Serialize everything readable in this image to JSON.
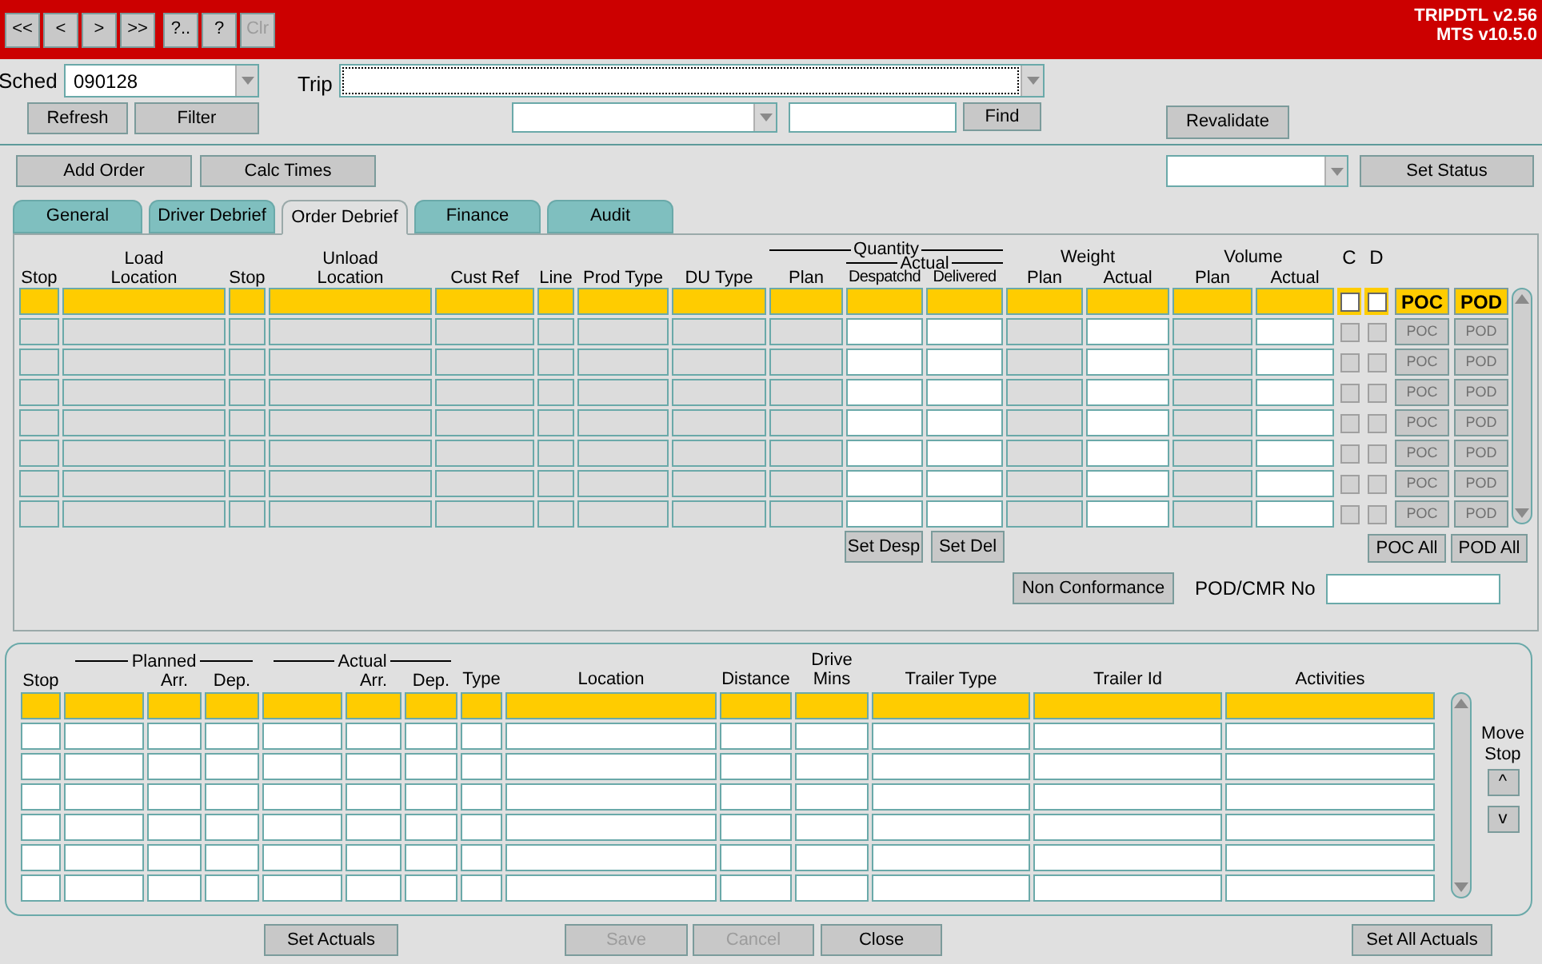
{
  "toolbar": {
    "buttons": [
      {
        "label": "<<",
        "disabled": false
      },
      {
        "label": "<",
        "disabled": false
      },
      {
        "label": ">",
        "disabled": false
      },
      {
        "label": ">>",
        "disabled": false
      },
      {
        "label": "?..",
        "disabled": false
      },
      {
        "label": "?",
        "disabled": false
      },
      {
        "label": "Clr",
        "disabled": true
      }
    ]
  },
  "app_info": [
    "TRIPDTL v2.56",
    "MTS v10.5.0"
  ],
  "sched": {
    "label": "Sched",
    "value": "090128"
  },
  "trip": {
    "label": "Trip",
    "focused": true
  },
  "schedule_buttons": [
    "Refresh",
    "Filter"
  ],
  "find_button": "Find",
  "revalidate_button": "Revalidate",
  "order_buttons": [
    "Add Order",
    "Calc Times"
  ],
  "set_status_button": "Set Status",
  "tabs": [
    {
      "label": "General",
      "selected": false
    },
    {
      "label": "Driver Debrief",
      "selected": false
    },
    {
      "label": "Order Debrief",
      "selected": true
    },
    {
      "label": "Finance",
      "selected": false
    },
    {
      "label": "Audit",
      "selected": false
    }
  ],
  "order_grid": {
    "groups": {
      "quantity": "Quantity",
      "actual": "Actual",
      "weight": "Weight",
      "volume": "Volume"
    },
    "columns": [
      {
        "label": "Stop",
        "editable": false
      },
      {
        "label": "Load\nLocation",
        "editable": false
      },
      {
        "label": "Stop",
        "editable": false
      },
      {
        "label": "Unload\nLocation",
        "editable": false
      },
      {
        "label": "Cust Ref",
        "editable": false
      },
      {
        "label": "Line",
        "editable": false
      },
      {
        "label": "Prod Type",
        "editable": false
      },
      {
        "label": "DU Type",
        "editable": false
      },
      {
        "label": "Plan",
        "editable": false
      },
      {
        "label": "Despatchd",
        "editable": true
      },
      {
        "label": "Delivered",
        "editable": true
      },
      {
        "label": "Plan",
        "editable": false
      },
      {
        "label": "Actual",
        "editable": true
      },
      {
        "label": "Plan",
        "editable": false
      },
      {
        "label": "Actual",
        "editable": true
      },
      {
        "label": "C"
      },
      {
        "label": "D"
      }
    ],
    "rows": [
      {
        "selected": true,
        "c_checked": false,
        "d_checked": false,
        "poc": "POC",
        "pod": "POD"
      },
      {
        "selected": false,
        "c_checked": false,
        "d_checked": false,
        "poc": "POC",
        "pod": "POD"
      },
      {
        "selected": false,
        "c_checked": false,
        "d_checked": false,
        "poc": "POC",
        "pod": "POD"
      },
      {
        "selected": false,
        "c_checked": false,
        "d_checked": false,
        "poc": "POC",
        "pod": "POD"
      },
      {
        "selected": false,
        "c_checked": false,
        "d_checked": false,
        "poc": "POC",
        "pod": "POD"
      },
      {
        "selected": false,
        "c_checked": false,
        "d_checked": false,
        "poc": "POC",
        "pod": "POD"
      },
      {
        "selected": false,
        "c_checked": false,
        "d_checked": false,
        "poc": "POC",
        "pod": "POD"
      },
      {
        "selected": false,
        "c_checked": false,
        "d_checked": false,
        "poc": "POC",
        "pod": "POD"
      }
    ]
  },
  "order_actions": [
    "Set Desp",
    "Set Del"
  ],
  "poc_all_button": "POC All",
  "pod_all_button": "POD All",
  "non_conformance_button": "Non Conformance",
  "pod_cmr": {
    "label": "POD/CMR No"
  },
  "stop_grid": {
    "groups": {
      "planned": "Planned",
      "actual": "Actual"
    },
    "columns": [
      {
        "label": "Stop"
      },
      {},
      {
        "label": "Arr."
      },
      {
        "label": "Dep."
      },
      {},
      {
        "label": "Arr."
      },
      {
        "label": "Dep."
      },
      {
        "label": "Type"
      },
      {
        "label": "Location"
      },
      {
        "label": "Distance"
      },
      {
        "label": "Drive\nMins"
      },
      {
        "label": "Trailer Type"
      },
      {
        "label": "Trailer Id"
      },
      {
        "label": "Activities"
      }
    ],
    "rows": [
      {
        "selected": true
      },
      {
        "selected": false
      },
      {
        "selected": false
      },
      {
        "selected": false
      },
      {
        "selected": false
      },
      {
        "selected": false
      },
      {
        "selected": false
      }
    ]
  },
  "move_stop": {
    "label": "Move Stop",
    "up": "^",
    "down": "v"
  },
  "footer_buttons": [
    {
      "label": "Set Actuals",
      "disabled": false
    },
    {
      "label": "Save",
      "disabled": true
    },
    {
      "label": "Cancel",
      "disabled": true
    },
    {
      "label": "Close",
      "disabled": false
    },
    {
      "label": "Set All Actuals",
      "disabled": false
    }
  ]
}
